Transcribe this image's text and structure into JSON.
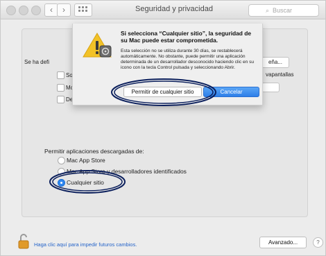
{
  "window": {
    "title": "Seguridad y privacidad",
    "search_placeholder": "Buscar",
    "nav_back": "‹",
    "nav_forward": "›"
  },
  "panel": {
    "general_prefix": "Se ha defi",
    "checkbox_1": "Sol",
    "checkbox_2": "Mo",
    "checkbox_3": "De",
    "side_button": "eña...",
    "side_text": "vapantallas"
  },
  "downloads": {
    "heading": "Permitir aplicaciones descargadas de:",
    "options": [
      {
        "label": "Mac App Store",
        "selected": false
      },
      {
        "label": "Mac App Store y desarrolladores identificados",
        "selected": false
      },
      {
        "label": "Cualquier sitio",
        "selected": true
      }
    ]
  },
  "sheet": {
    "title": "Si selecciona “Cualquier sitio”, la seguridad de su Mac puede estar comprometida.",
    "body": "Esta selección no se utiliza durante 30 días, se restablecerá automáticamente. No obstante, puede permitir una aplicación determinada de un desarrollador desconocido haciendo clic en su icono con la tecla Control pulsada y seleccionando Abrir.",
    "permit_button": "Permitir de cualquier sitio",
    "cancel_button": "Cancelar"
  },
  "footer": {
    "lock_text": "Haga clic aquí para impedir futuros cambios.",
    "advanced_button": "Avanzado...",
    "help": "?"
  },
  "colors": {
    "accent": "#2f86ee",
    "link": "#2463c9",
    "annotation": "#0b1f5c"
  },
  "icons": [
    "lock-icon",
    "warning-icon",
    "search-icon",
    "grid-icon",
    "help-icon"
  ]
}
